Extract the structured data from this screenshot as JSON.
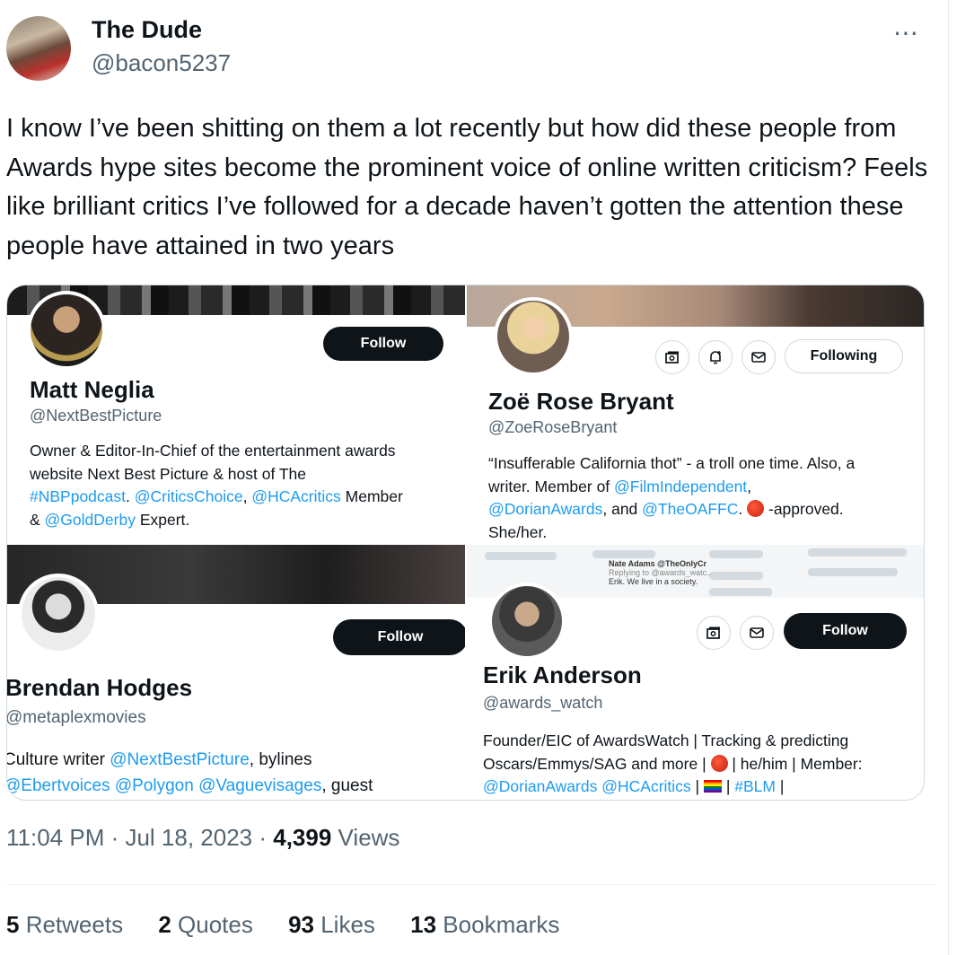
{
  "author": {
    "display_name": "The Dude",
    "handle": "@bacon5237",
    "avatar_icon": "profile-avatar"
  },
  "more_icon": "⋯",
  "tweet_text": "I know I’ve been shitting on them a lot recently but how did these people from Awards hype sites become the prominent voice of online written criticism? Feels like brilliant critics I’ve followed for a decade  haven’t gotten the attention these people have attained in two years",
  "profiles": [
    {
      "name": "Matt Neglia",
      "handle": "@NextBestPicture",
      "button": "Follow",
      "bio": {
        "l1": "Owner & Editor-In-Chief of the entertainment awards",
        "l2": "website Next Best Picture & host of The",
        "l3a": "#NBPpodcast",
        "l3b": ". ",
        "l3c": "@CriticsChoice",
        "l3d": ", ",
        "l3e": "@HCAcritics",
        "l3f": " Member",
        "l4a": "& ",
        "l4b": "@GoldDerby",
        "l4c": " Expert."
      }
    },
    {
      "name": "Zoë Rose Bryant",
      "handle": "@ZoeRoseBryant",
      "button": "Following",
      "bio": {
        "l1": "“Insufferable California thot” - a troll one time. Also, a",
        "l2a": "writer. Member of ",
        "l2b": "@FilmIndependent",
        "l2c": ",",
        "l3a": "@DorianAwards",
        "l3b": ", and ",
        "l3c": "@TheOAFFC",
        "l3d": ". ",
        "l3e": " -approved.",
        "l4": "She/her."
      }
    },
    {
      "name": "Brendan Hodges",
      "handle": "@metaplexmovies",
      "button": "Follow",
      "bio": {
        "l1a": "Culture writer ",
        "l1b": "@NextBestPicture",
        "l1c": ", bylines",
        "l2a": "@Ebertvoices",
        "l2b": " ",
        "l2c": "@Polygon",
        "l2d": " ",
        "l2e": "@Vaguevisages",
        "l2f": ", guest"
      }
    },
    {
      "name": "Erik Anderson",
      "handle": "@awards_watch",
      "button": "Follow",
      "bio": {
        "l1": "Founder/EIC of AwardsWatch | Tracking & predicting",
        "l2a": "Oscars/Emmys/SAG and more | ",
        "l2b": " | he/him | Member:",
        "l3a": "@DorianAwards",
        "l3b": " ",
        "l3c": "@HCAcritics",
        "l3d": " | ",
        "l3e": " | ",
        "l3f": "#BLM",
        "l3g": " |"
      },
      "banner_text": {
        "a": "Nate Adams @TheOnlyCr",
        "b": "Replying to @awards_watc..",
        "c": "Erik. We live in a society."
      }
    }
  ],
  "meta": {
    "time": "11:04 PM",
    "sep1": " · ",
    "date": "Jul 18, 2023",
    "sep2": " · ",
    "views_count": "4,399",
    "views_label": " Views"
  },
  "stats": [
    {
      "count": "5",
      "label": " Retweets"
    },
    {
      "count": "2",
      "label": " Quotes"
    },
    {
      "count": "93",
      "label": " Likes"
    },
    {
      "count": "13",
      "label": " Bookmarks"
    }
  ],
  "colors": {
    "link": "#1d9bf0",
    "text": "#0f1419",
    "secondary": "#536471",
    "button_dark": "#0f1419"
  }
}
